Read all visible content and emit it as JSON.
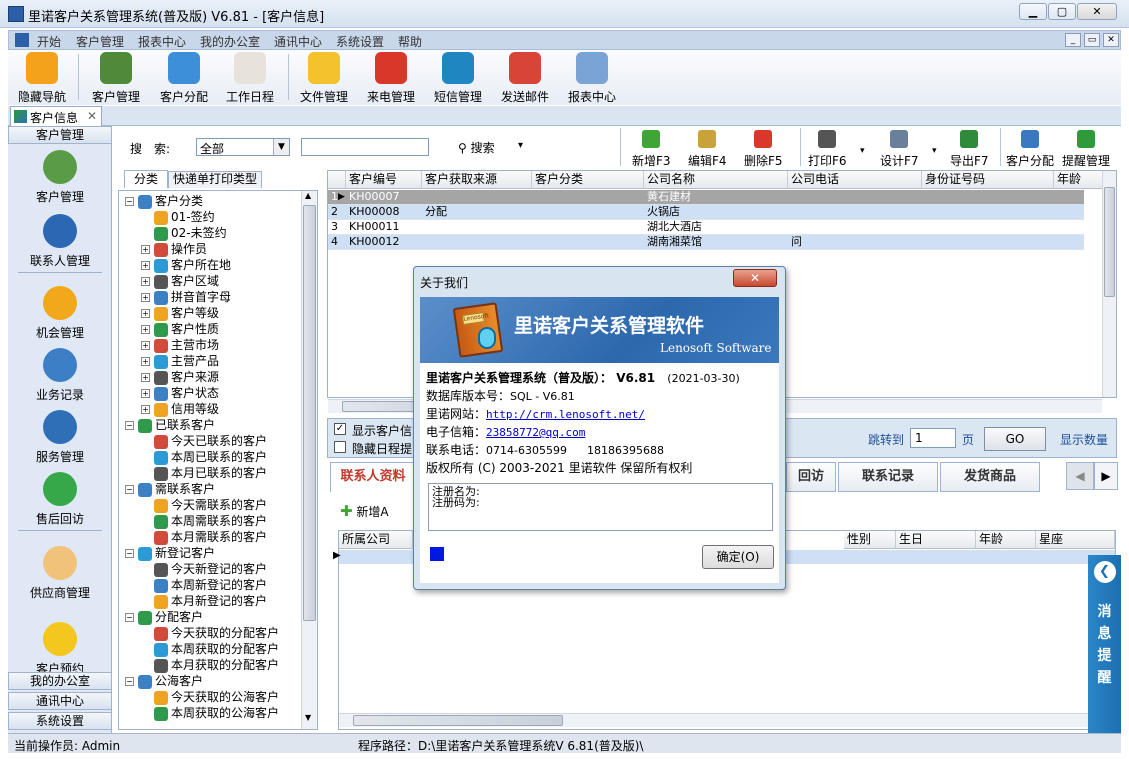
{
  "window": {
    "title": "里诺客户关系管理系统(普及版) V6.81 - [客户信息]"
  },
  "menu": [
    "开始",
    "客户管理",
    "报表中心",
    "我的办公室",
    "通讯中心",
    "系统设置",
    "帮助"
  ],
  "toolbar": [
    {
      "label": "隐藏导航",
      "icon": "butterfly-icon",
      "color": "#f4a21b"
    },
    {
      "label": "客户管理",
      "icon": "users-icon",
      "color": "#4f8a3a"
    },
    {
      "label": "客户分配",
      "icon": "share-icon",
      "color": "#3c8fd8"
    },
    {
      "label": "工作日程",
      "icon": "calendar-icon",
      "color": "#e7e3da"
    },
    {
      "label": "文件管理",
      "icon": "folder-icon",
      "color": "#f3c22c"
    },
    {
      "label": "来电管理",
      "icon": "phone-icon",
      "color": "#d9372a"
    },
    {
      "label": "短信管理",
      "icon": "sms-icon",
      "color": "#1f86c2"
    },
    {
      "label": "发送邮件",
      "icon": "mail-icon",
      "color": "#d84437"
    },
    {
      "label": "报表中心",
      "icon": "report-icon",
      "color": "#7aa3d6"
    }
  ],
  "doc_tab": {
    "label": "客户信息",
    "close": "✕"
  },
  "leftnav": {
    "header": "客户管理",
    "items": [
      {
        "label": "客户管理",
        "icon": "users-icon",
        "color": "#5a9b46"
      },
      {
        "label": "联系人管理",
        "icon": "contact-icon",
        "color": "#2c67b3"
      },
      {
        "label": "机会管理",
        "icon": "star-icon",
        "color": "#f2a81b"
      },
      {
        "label": "业务记录",
        "icon": "chart-icon",
        "color": "#3d7fc6"
      },
      {
        "label": "服务管理",
        "icon": "globe-icon",
        "color": "#2f6fb8"
      },
      {
        "label": "售后回访",
        "icon": "chat-icon",
        "color": "#35a84a"
      },
      {
        "label": "供应商管理",
        "icon": "person-icon",
        "color": "#f0c27a"
      },
      {
        "label": "客户预约",
        "icon": "headset-icon",
        "color": "#f3c71d"
      }
    ],
    "bottom": [
      "我的办公室",
      "通讯中心",
      "系统设置"
    ]
  },
  "search": {
    "label": "搜　索:",
    "scope": "全部",
    "button": "搜索",
    "dropdown": "▾"
  },
  "actions": [
    {
      "label": "新增F3",
      "icon": "plus-icon",
      "color": "#3fa535"
    },
    {
      "label": "编辑F4",
      "icon": "edit-icon",
      "color": "#c9a23a"
    },
    {
      "label": "删除F5",
      "icon": "delete-icon",
      "color": "#d9372a"
    },
    {
      "label": "打印F6",
      "icon": "print-icon",
      "color": "#555555"
    },
    {
      "label": "设计F7",
      "icon": "design-icon",
      "color": "#6a7f99"
    },
    {
      "label": "导出F7",
      "icon": "excel-icon",
      "color": "#2f8a3b"
    },
    {
      "label": "客户分配",
      "icon": "assign-icon",
      "color": "#3c78c2"
    },
    {
      "label": "提醒管理",
      "icon": "check-icon",
      "color": "#2e9a3a"
    }
  ],
  "tree_tabs": [
    "分类",
    "快递单打印类型"
  ],
  "tree": [
    {
      "label": "客户分类",
      "level": 0,
      "exp": "−"
    },
    {
      "label": "01-签约",
      "level": 1
    },
    {
      "label": "02-未签约",
      "level": 1
    },
    {
      "label": "操作员",
      "level": 1,
      "exp": "+"
    },
    {
      "label": "客户所在地",
      "level": 1,
      "exp": "+"
    },
    {
      "label": "客户区域",
      "level": 1,
      "exp": "+"
    },
    {
      "label": "拼音首字母",
      "level": 1,
      "exp": "+"
    },
    {
      "label": "客户等级",
      "level": 1,
      "exp": "+"
    },
    {
      "label": "客户性质",
      "level": 1,
      "exp": "+"
    },
    {
      "label": "主营市场",
      "level": 1,
      "exp": "+"
    },
    {
      "label": "主营产品",
      "level": 1,
      "exp": "+"
    },
    {
      "label": "客户来源",
      "level": 1,
      "exp": "+"
    },
    {
      "label": "客户状态",
      "level": 1,
      "exp": "+"
    },
    {
      "label": "信用等级",
      "level": 1,
      "exp": "+"
    },
    {
      "label": "已联系客户",
      "level": 0,
      "exp": "−"
    },
    {
      "label": "今天已联系的客户",
      "level": 1
    },
    {
      "label": "本周已联系的客户",
      "level": 1
    },
    {
      "label": "本月已联系的客户",
      "level": 1
    },
    {
      "label": "需联系客户",
      "level": 0,
      "exp": "−"
    },
    {
      "label": "今天需联系的客户",
      "level": 1
    },
    {
      "label": "本周需联系的客户",
      "level": 1
    },
    {
      "label": "本月需联系的客户",
      "level": 1
    },
    {
      "label": "新登记客户",
      "level": 0,
      "exp": "−"
    },
    {
      "label": "今天新登记的客户",
      "level": 1
    },
    {
      "label": "本周新登记的客户",
      "level": 1
    },
    {
      "label": "本月新登记的客户",
      "level": 1
    },
    {
      "label": "分配客户",
      "level": 0,
      "exp": "−"
    },
    {
      "label": "今天获取的分配客户",
      "level": 1
    },
    {
      "label": "本周获取的分配客户",
      "level": 1
    },
    {
      "label": "本月获取的分配客户",
      "level": 1
    },
    {
      "label": "公海客户",
      "level": 0,
      "exp": "−"
    },
    {
      "label": "今天获取的公海客户",
      "level": 1
    },
    {
      "label": "本周获取的公海客户",
      "level": 1
    }
  ],
  "grid": {
    "columns": [
      "客户编号",
      "客户获取来源",
      "客户分类",
      "公司名称",
      "公司电话",
      "身份证号码",
      "年龄"
    ],
    "rows": [
      [
        "1",
        "KH00007",
        "",
        "",
        "黄石建材",
        "",
        "",
        ""
      ],
      [
        "2",
        "KH00008",
        "分配",
        "",
        "火锅店",
        "",
        "",
        ""
      ],
      [
        "3",
        "KH00011",
        "",
        "",
        "湖北大酒店",
        "",
        "",
        ""
      ],
      [
        "4",
        "KH00012",
        "",
        "",
        "湖南湘菜馆",
        "问",
        "",
        ""
      ]
    ]
  },
  "checks": {
    "show": "显示客户信",
    "hide": "隐藏日程提",
    "jump": "跳转到",
    "page_value": "1",
    "page": "页",
    "go": "GO",
    "count": "显示数量"
  },
  "bottom_tabs": [
    "联系人资料",
    "回访",
    "联系记录",
    "发货商品"
  ],
  "sub": {
    "add": "新增A",
    "columns": [
      "所属公司",
      "性别",
      "生日",
      "年龄",
      "星座"
    ]
  },
  "msg_panel": "消息提醒",
  "status": {
    "operator": "当前操作员: Admin",
    "path": "程序路径：D:\\里诺客户关系管理系统V 6.81(普及版)\\"
  },
  "dialog": {
    "title": "关于我们",
    "close": "✕",
    "banner_title": "里诺客户关系管理软件",
    "banner_sub": "Lenosoft Software",
    "book_label": "Lenosoft",
    "product": "里诺客户关系管理系统（普及版）：",
    "version": "V6.81",
    "date": "(2021-03-30)",
    "db_label": "数据库版本号：",
    "db_value": "SQL - V6.81",
    "site_label": "里诺网站：",
    "site": "http://crm.lenosoft.net/",
    "email_label": "电子信箱：",
    "email": "23858772@qq.com",
    "phone_label": "联系电话：",
    "phone1": "0714-6305599",
    "phone2": "18186395688",
    "copyright": "版权所有 (C) 2003-2021 里诺软件 保留所有权利",
    "reg_name": "注册名为:",
    "reg_code": "注册码为:",
    "ok": "确定(O)"
  }
}
